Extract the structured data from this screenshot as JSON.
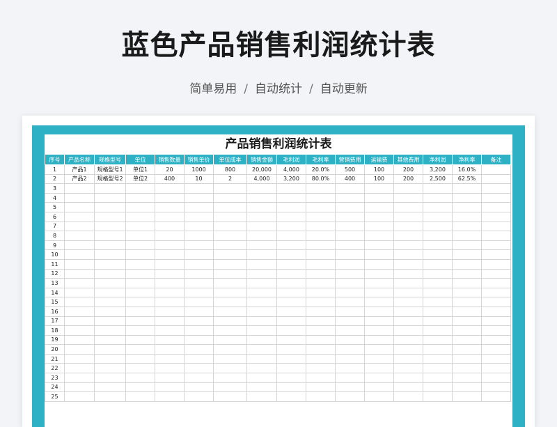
{
  "title": "蓝色产品销售利润统计表",
  "subtitle": {
    "items": [
      "简单易用",
      "自动统计",
      "自动更新"
    ],
    "separator": "/"
  },
  "sheet": {
    "title": "产品销售利润统计表",
    "headers": [
      "序号",
      "产品名称",
      "规格型号",
      "单位",
      "销售数量",
      "销售单价",
      "单位成本",
      "销售金额",
      "毛利润",
      "毛利率",
      "营销费用",
      "运输费",
      "其他费用",
      "净利润",
      "净利率",
      "备注"
    ],
    "rows": [
      [
        "1",
        "产品1",
        "规格型号1",
        "单位1",
        "20",
        "1000",
        "800",
        "20,000",
        "4,000",
        "20.0%",
        "500",
        "100",
        "200",
        "3,200",
        "16.0%",
        ""
      ],
      [
        "2",
        "产品2",
        "规格型号2",
        "单位2",
        "400",
        "10",
        "2",
        "4,000",
        "3,200",
        "80.0%",
        "400",
        "100",
        "200",
        "2,500",
        "62.5%",
        ""
      ],
      [
        "3"
      ],
      [
        "4"
      ],
      [
        "5"
      ],
      [
        "6"
      ],
      [
        "7"
      ],
      [
        "8"
      ],
      [
        "9"
      ],
      [
        "10"
      ],
      [
        "11"
      ],
      [
        "12"
      ],
      [
        "13"
      ],
      [
        "14"
      ],
      [
        "15"
      ],
      [
        "16"
      ],
      [
        "17"
      ],
      [
        "18"
      ],
      [
        "19"
      ],
      [
        "20"
      ],
      [
        "21"
      ],
      [
        "22"
      ],
      [
        "23"
      ],
      [
        "24"
      ],
      [
        "25"
      ]
    ]
  },
  "colors": {
    "accent": "#2eb1c4",
    "background": "#f2f4f7"
  }
}
